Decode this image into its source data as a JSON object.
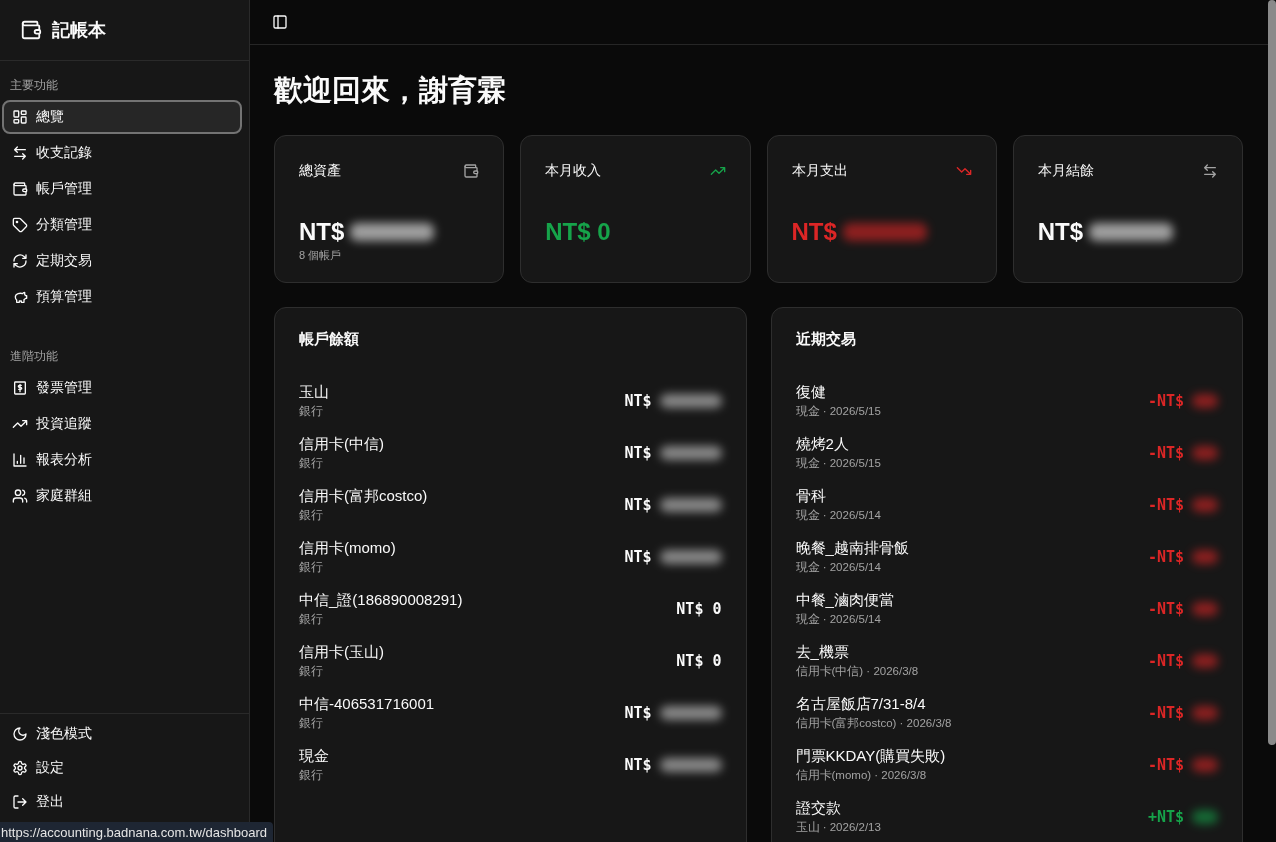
{
  "app": {
    "title": "記帳本"
  },
  "sidebar": {
    "sections": [
      {
        "heading": "主要功能",
        "items": [
          {
            "label": "總覽",
            "selected": true
          },
          {
            "label": "收支記錄",
            "selected": false
          },
          {
            "label": "帳戶管理",
            "selected": false
          },
          {
            "label": "分類管理",
            "selected": false
          },
          {
            "label": "定期交易",
            "selected": false
          },
          {
            "label": "預算管理",
            "selected": false
          }
        ]
      },
      {
        "heading": "進階功能",
        "items": [
          {
            "label": "發票管理",
            "selected": false
          },
          {
            "label": "投資追蹤",
            "selected": false
          },
          {
            "label": "報表分析",
            "selected": false
          },
          {
            "label": "家庭群組",
            "selected": false
          }
        ]
      }
    ],
    "footer": [
      {
        "label": "淺色模式"
      },
      {
        "label": "設定"
      },
      {
        "label": "登出"
      }
    ]
  },
  "greeting": "歡迎回來，謝育霖",
  "summary_cards": [
    {
      "title": "總資產",
      "kind": "neutral",
      "currency": "NT$",
      "masked": true,
      "note": "8 個帳戶"
    },
    {
      "title": "本月收入",
      "kind": "income",
      "currency": "NT$",
      "value": "0",
      "masked": false
    },
    {
      "title": "本月支出",
      "kind": "expense",
      "currency": "NT$",
      "masked": true
    },
    {
      "title": "本月結餘",
      "kind": "neutral",
      "currency": "NT$",
      "masked": true
    }
  ],
  "accounts": {
    "title": "帳戶餘額",
    "rows": [
      {
        "name": "玉山",
        "type": "銀行",
        "currency": "NT$",
        "masked": true
      },
      {
        "name": "信用卡(中信)",
        "type": "銀行",
        "currency": "NT$",
        "masked": true
      },
      {
        "name": "信用卡(富邦costco)",
        "type": "銀行",
        "currency": "NT$",
        "masked": true
      },
      {
        "name": "信用卡(momo)",
        "type": "銀行",
        "currency": "NT$",
        "masked": true
      },
      {
        "name": "中信_證(186890008291)",
        "type": "銀行",
        "currency": "NT$",
        "value": "0",
        "masked": false
      },
      {
        "name": "信用卡(玉山)",
        "type": "銀行",
        "currency": "NT$",
        "value": "0",
        "masked": false
      },
      {
        "name": "中信-406531716001",
        "type": "銀行",
        "currency": "NT$",
        "masked": true
      },
      {
        "name": "現金",
        "type": "銀行",
        "currency": "NT$",
        "masked": true
      }
    ]
  },
  "transactions": {
    "title": "近期交易",
    "rows": [
      {
        "name": "復健",
        "meta": "現金 · 2026/5/15",
        "kind": "expense",
        "currency": "-NT$",
        "masked": true
      },
      {
        "name": "燒烤2人",
        "meta": "現金 · 2026/5/15",
        "kind": "expense",
        "currency": "-NT$",
        "masked": true
      },
      {
        "name": "骨科",
        "meta": "現金 · 2026/5/14",
        "kind": "expense",
        "currency": "-NT$",
        "masked": true
      },
      {
        "name": "晚餐_越南排骨飯",
        "meta": "現金 · 2026/5/14",
        "kind": "expense",
        "currency": "-NT$",
        "masked": true
      },
      {
        "name": "中餐_滷肉便當",
        "meta": "現金 · 2026/5/14",
        "kind": "expense",
        "currency": "-NT$",
        "masked": true
      },
      {
        "name": "去_機票",
        "meta": "信用卡(中信) · 2026/3/8",
        "kind": "expense",
        "currency": "-NT$",
        "masked": true
      },
      {
        "name": "名古屋飯店7/31-8/4",
        "meta": "信用卡(富邦costco) · 2026/3/8",
        "kind": "expense",
        "currency": "-NT$",
        "masked": true
      },
      {
        "name": "門票KKDAY(購買失敗)",
        "meta": "信用卡(momo) · 2026/3/8",
        "kind": "expense",
        "currency": "-NT$",
        "masked": true
      },
      {
        "name": "證交款",
        "meta": "玉山 · 2026/2/13",
        "kind": "income",
        "currency": "+NT$",
        "masked": true
      }
    ]
  },
  "status_url": "https://accounting.badnana.com.tw/dashboard"
}
